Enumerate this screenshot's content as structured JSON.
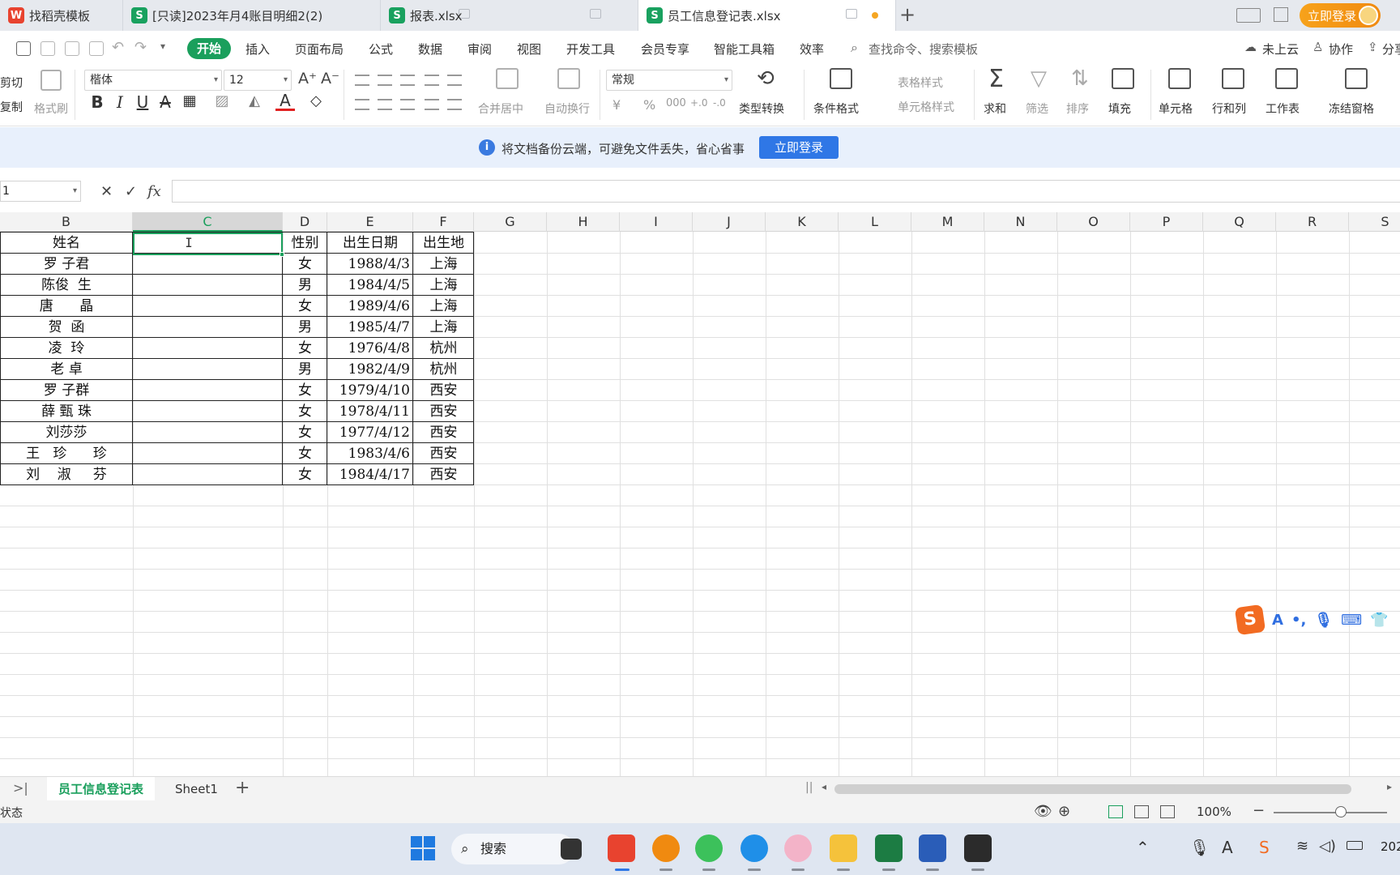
{
  "tabs": [
    {
      "label": "找稻壳模板",
      "icon": "wps-logo-icon"
    },
    {
      "label": "[只读]2023年月4账目明细2(2)",
      "icon": "sheet-icon"
    },
    {
      "label": "报表.xlsx",
      "icon": "sheet-icon"
    },
    {
      "label": "员工信息登记表.xlsx",
      "icon": "sheet-icon"
    }
  ],
  "tabbar": {
    "new_tab": "+",
    "login": "立即登录"
  },
  "menu": {
    "active": "开始",
    "items": [
      "插入",
      "页面布局",
      "公式",
      "数据",
      "审阅",
      "视图",
      "开发工具",
      "会员专享",
      "智能工具箱",
      "效率"
    ],
    "search_placeholder": "查找命令、搜索模板",
    "right": [
      "未上云",
      "协作",
      "分享"
    ]
  },
  "ribbon": {
    "cut": "剪切",
    "copy": "复制",
    "format_painter": "格式刷",
    "font_name": "楷体",
    "font_size": "12",
    "merge_center": "合并居中",
    "wrap_text": "自动换行",
    "number_format": "常规",
    "type_convert": "类型转换",
    "conditional_format": "条件格式",
    "table_style": "表格样式",
    "cell_style": "单元格样式",
    "sum": "求和",
    "filter": "筛选",
    "sort": "排序",
    "fill": "填充",
    "cell": "单元格",
    "row_col": "行和列",
    "worksheet": "工作表",
    "freeze": "冻结窗格",
    "currency_symbol": "¥",
    "percent_symbol": "%",
    "thousands": "000",
    "dec_increase": "+.0",
    "dec_decrease": "-.0"
  },
  "notice": {
    "text": "将文档备份云端，可避免文件丢失，省心省事",
    "button": "立即登录"
  },
  "formula_bar": {
    "name_box": "1",
    "fx": "fx",
    "formula": ""
  },
  "grid": {
    "columns": [
      "B",
      "C",
      "D",
      "E",
      "F",
      "G",
      "H",
      "I",
      "J",
      "K",
      "L",
      "M",
      "N",
      "O",
      "P",
      "Q",
      "R",
      "S"
    ],
    "selected_column": "C",
    "headers": [
      "姓名",
      "",
      "性别",
      "出生日期",
      "出生地"
    ],
    "rows": [
      [
        "罗 子君",
        "",
        "女",
        "1988/4/3",
        "上海"
      ],
      [
        "陈俊  生",
        "",
        "男",
        "1984/4/5",
        "上海"
      ],
      [
        "唐      晶",
        "",
        "女",
        "1989/4/6",
        "上海"
      ],
      [
        "贺  函",
        "",
        "男",
        "1985/4/7",
        "上海"
      ],
      [
        "凌  玲",
        "",
        "女",
        "1976/4/8",
        "杭州"
      ],
      [
        "老 卓",
        "",
        "男",
        "1982/4/9",
        "杭州"
      ],
      [
        "罗 子群",
        "",
        "女",
        "1979/4/10",
        "西安"
      ],
      [
        "薛 甄 珠",
        "",
        "女",
        "1978/4/11",
        "西安"
      ],
      [
        "刘莎莎",
        "",
        "女",
        "1977/4/12",
        "西安"
      ],
      [
        "王   珍      珍",
        "",
        "女",
        "1983/4/6",
        "西安"
      ],
      [
        "刘    淑     芬",
        "",
        "女",
        "1984/4/17",
        "西安"
      ]
    ]
  },
  "sheets": {
    "active": "员工信息登记表",
    "other": "Sheet1",
    "add": "+"
  },
  "status": {
    "text": "状态",
    "zoom": "100%"
  },
  "taskbar": {
    "search": "搜索",
    "clock": "202"
  }
}
